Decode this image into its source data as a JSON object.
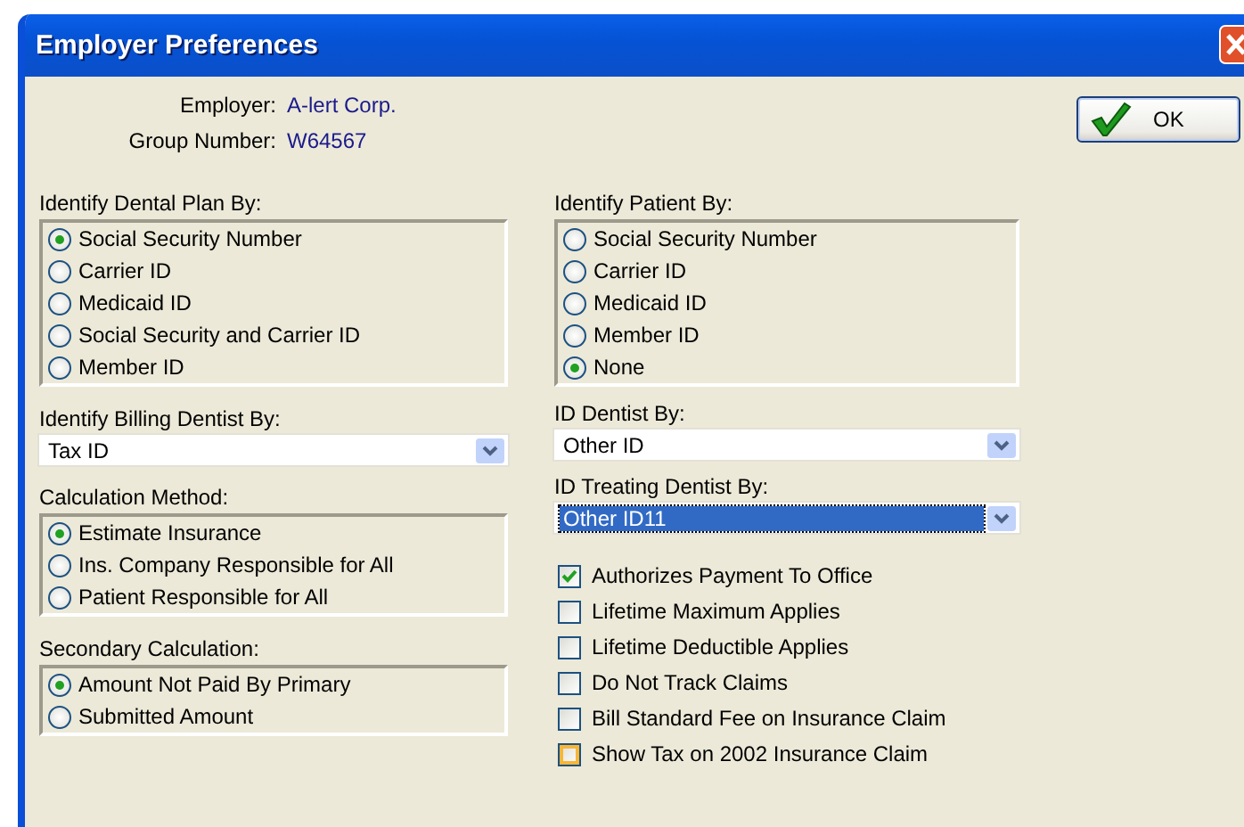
{
  "window": {
    "title": "Employer Preferences"
  },
  "employer": {
    "label": "Employer:",
    "value": "A-lert Corp."
  },
  "group_number": {
    "label": "Group Number:",
    "value": "W64567"
  },
  "ok_button": {
    "label": "OK"
  },
  "left_column": [
    {
      "kind": "radio_group",
      "label": "Identify Dental Plan By:",
      "options": [
        {
          "label": "Social Security Number",
          "selected": true
        },
        {
          "label": "Carrier ID",
          "selected": false
        },
        {
          "label": "Medicaid ID",
          "selected": false
        },
        {
          "label": "Social Security and Carrier ID",
          "selected": false
        },
        {
          "label": "Member ID",
          "selected": false
        }
      ]
    },
    {
      "kind": "dropdown",
      "label": "Identify Billing Dentist By:",
      "value": "Tax ID",
      "focused": false
    },
    {
      "kind": "radio_group",
      "label": "Calculation Method:",
      "options": [
        {
          "label": "Estimate Insurance",
          "selected": true
        },
        {
          "label": "Ins. Company Responsible for All",
          "selected": false
        },
        {
          "label": "Patient Responsible for All",
          "selected": false
        }
      ]
    },
    {
      "kind": "radio_group",
      "label": "Secondary Calculation:",
      "options": [
        {
          "label": "Amount Not Paid By Primary",
          "selected": true
        },
        {
          "label": "Submitted Amount",
          "selected": false
        }
      ]
    }
  ],
  "right_column": [
    {
      "kind": "radio_group",
      "label": "Identify Patient By:",
      "options": [
        {
          "label": "Social Security Number",
          "selected": false
        },
        {
          "label": "Carrier ID",
          "selected": false
        },
        {
          "label": "Medicaid ID",
          "selected": false
        },
        {
          "label": "Member ID",
          "selected": false
        },
        {
          "label": "None",
          "selected": true
        }
      ]
    },
    {
      "kind": "dropdown",
      "label": "ID Dentist By:",
      "value": "Other ID",
      "focused": false
    },
    {
      "kind": "dropdown",
      "label": "ID Treating Dentist By:",
      "value": "Other ID11",
      "focused": true
    },
    {
      "kind": "checkbox_list",
      "items": [
        {
          "label": "Authorizes Payment To Office",
          "checked": true,
          "hot": false
        },
        {
          "label": "Lifetime Maximum Applies",
          "checked": false,
          "hot": false
        },
        {
          "label": "Lifetime Deductible Applies",
          "checked": false,
          "hot": false
        },
        {
          "label": "Do Not Track Claims",
          "checked": false,
          "hot": false
        },
        {
          "label": "Bill Standard Fee on Insurance Claim",
          "checked": false,
          "hot": false
        },
        {
          "label": "Show Tax on 2002 Insurance Claim",
          "checked": false,
          "hot": true
        }
      ]
    }
  ]
}
